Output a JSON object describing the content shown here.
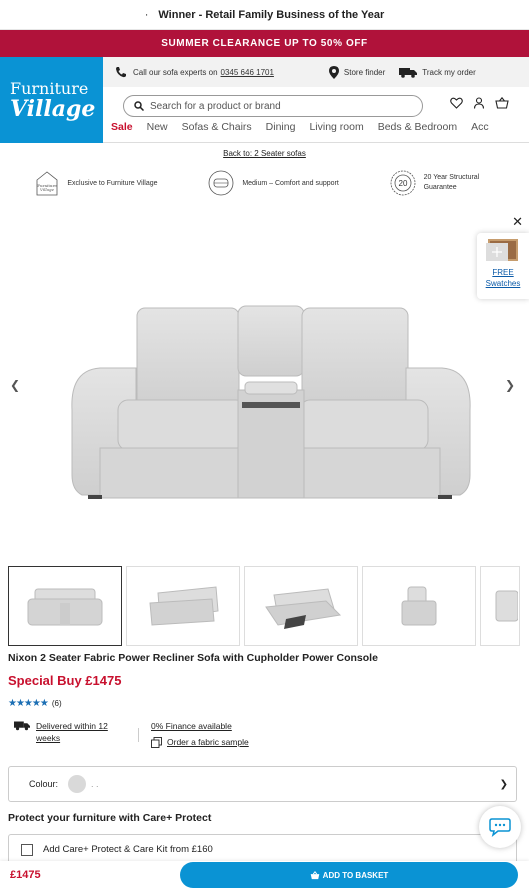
{
  "top_banner": {
    "bullet": "·",
    "text": "Winner - Retail Family Business of the Year"
  },
  "sale_strip": {
    "text": "SUMMER CLEARANCE UP TO 50% OFF"
  },
  "logo": {
    "line1": "Furniture",
    "line2": "Village"
  },
  "utility": {
    "call_prefix": "Call our",
    "call_experts": "sofa experts",
    "call_on": "on",
    "phone": "0345 646 1701",
    "store_finder": "Store finder",
    "track_order": "Track my order"
  },
  "search": {
    "placeholder": "Search for a product or brand"
  },
  "nav": {
    "items": [
      "Sale",
      "New",
      "Sofas & Chairs",
      "Dining",
      "Living room",
      "Beds & Bedroom",
      "Acc"
    ]
  },
  "breadcrumb": {
    "back": "Back to: 2 Seater sofas"
  },
  "features": [
    {
      "icon": "furniture-village-badge-icon",
      "text": "Exclusive to Furniture Village"
    },
    {
      "icon": "cushion-comfort-icon",
      "text": "Medium – Comfort and support"
    },
    {
      "icon": "guarantee-20-icon",
      "badge": "20",
      "text": "20 Year Structural Guarantee"
    }
  ],
  "swatch_card": {
    "label1": "FREE",
    "label2": "Swatches"
  },
  "product": {
    "title": "Nixon 2 Seater Fabric Power Recliner Sofa with Cupholder Power Console",
    "price_label": "Special Buy £1475",
    "rating_stars": "★★★★★",
    "rating": 5,
    "review_count": "(6)",
    "delivery": "Delivered within 12 weeks",
    "finance": "0% Finance available",
    "sample": "Order a fabric sample",
    "colour_label": "Colour:",
    "colour_value": ". .",
    "care_title": "Protect your furniture with Care+ Protect",
    "care_option": "Add Care+ Protect & Care Kit from £160"
  },
  "bottom_bar": {
    "price": "£1475",
    "basket_label": "ADD TO BASKET"
  },
  "colors": {
    "brand_blue": "#0a93d4",
    "sale_red": "#b0123a",
    "price_red": "#c8102e"
  }
}
